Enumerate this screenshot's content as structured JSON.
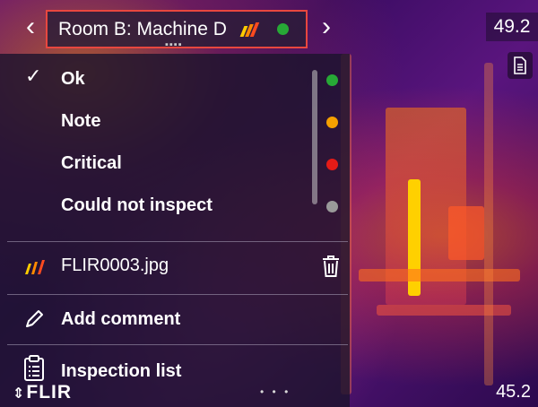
{
  "header": {
    "title": "Room B: Machine D",
    "title_status_color": "#27a836",
    "prev_icon": "chevron-left-icon",
    "next_icon": "chevron-right-icon",
    "prev_glyph": "‹",
    "next_glyph": "›",
    "grip": "▪▪▪▪"
  },
  "temperatures": {
    "top": "49.2",
    "bottom": "45.2"
  },
  "status_options": [
    {
      "label": "Ok",
      "selected": true,
      "color": "#27a836",
      "check": "✓"
    },
    {
      "label": "Note",
      "selected": false,
      "color": "#f5a000",
      "check": ""
    },
    {
      "label": "Critical",
      "selected": false,
      "color": "#e41b17",
      "check": ""
    },
    {
      "label": "Could not inspect",
      "selected": false,
      "color": "#9a9a9a",
      "check": ""
    }
  ],
  "image_item": {
    "filename": "FLIR0003.jpg",
    "icon": "flir-image-icon",
    "delete_icon": "trash-icon"
  },
  "add_comment": {
    "label": "Add comment",
    "icon": "pencil-icon"
  },
  "inspection_list": {
    "label": "Inspection list",
    "icon": "clipboard-list-icon"
  },
  "brand": {
    "logo_text": "FLIR",
    "logo_arrow": "⇕"
  },
  "bottom_handle": "• • •"
}
